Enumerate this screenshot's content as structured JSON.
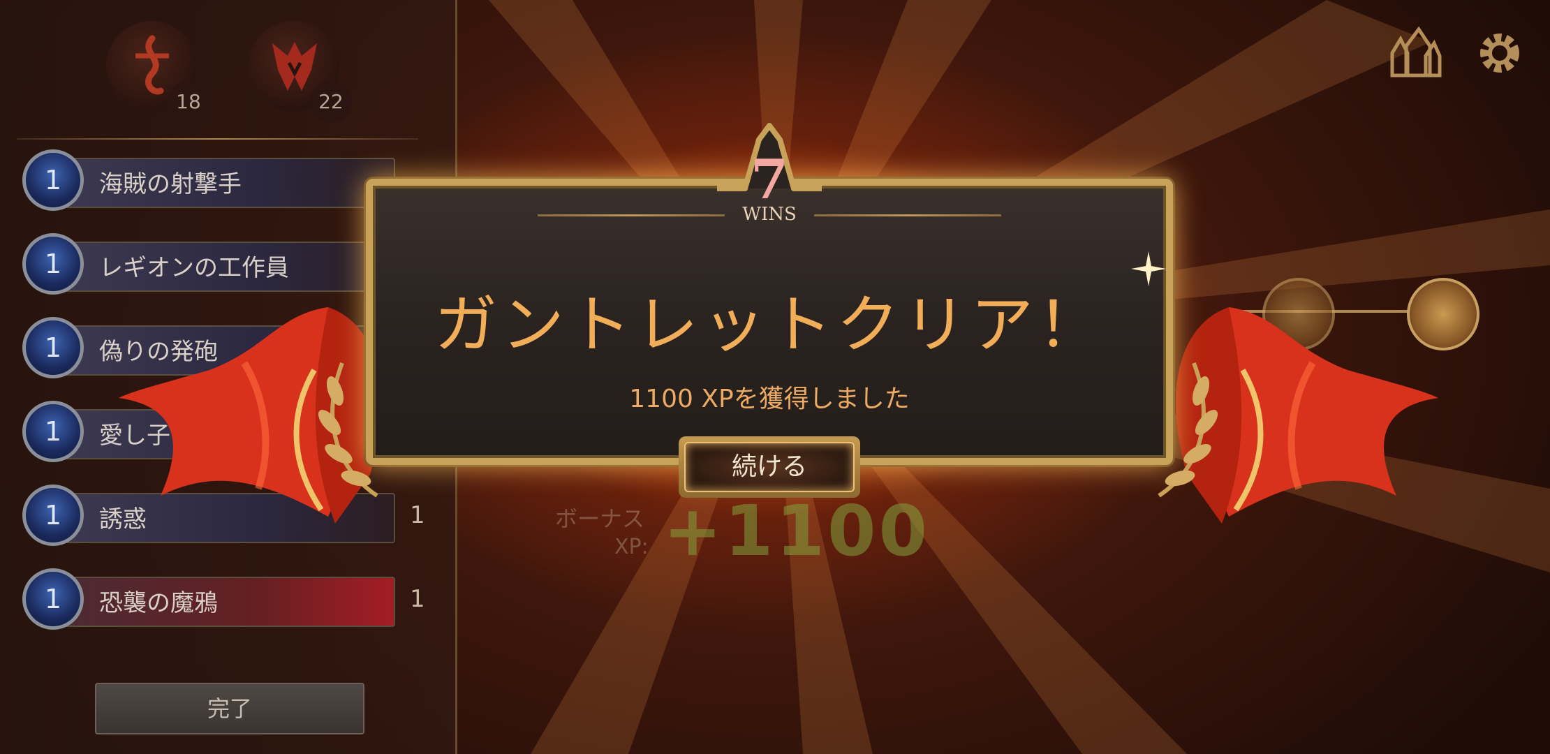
{
  "regions": [
    {
      "icon": "bilgewater-icon",
      "count": "18"
    },
    {
      "icon": "noxus-icon",
      "count": "22"
    }
  ],
  "deck_list": [
    {
      "cost": "1",
      "name": "海賊の射撃手",
      "qty": ""
    },
    {
      "cost": "1",
      "name": "レギオンの工作員",
      "qty": ""
    },
    {
      "cost": "1",
      "name": "偽りの発砲",
      "qty": ""
    },
    {
      "cost": "1",
      "name": "愛し子",
      "qty": ""
    },
    {
      "cost": "1",
      "name": "誘惑",
      "qty": "1"
    },
    {
      "cost": "1",
      "name": "恐襲の魔鴉",
      "qty": "1"
    }
  ],
  "done_label": "完了",
  "background": {
    "bonus_label": "ボーナス",
    "xp_label": "XP:",
    "xp_value": "+1100"
  },
  "dialog": {
    "wins_count": "7",
    "wins_label": "WINS",
    "title": "ガントレットクリア！",
    "subtitle": "1100 XPを獲得しました",
    "continue_label": "続ける"
  },
  "colors": {
    "title": "#f2ad59",
    "frame_gold": "#c9a25a",
    "ribbon_red": "#d8321c"
  }
}
